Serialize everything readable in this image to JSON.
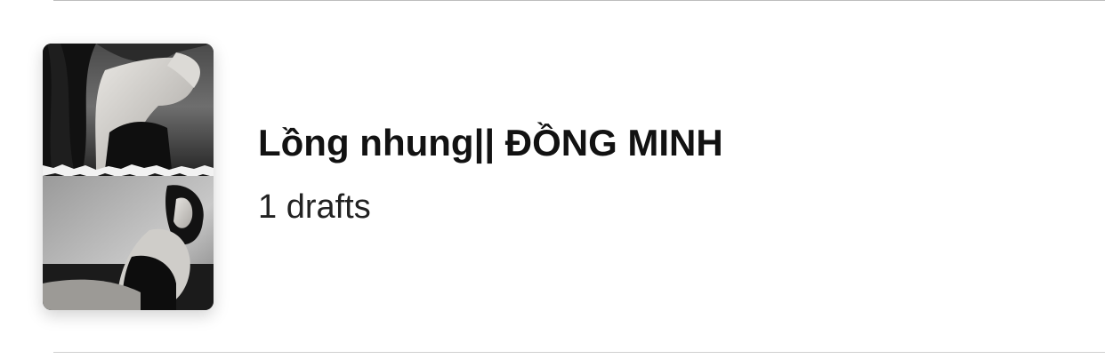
{
  "story": {
    "title": "Lồng nhung|| ĐỒNG MINH",
    "drafts_label": "1 drafts"
  }
}
